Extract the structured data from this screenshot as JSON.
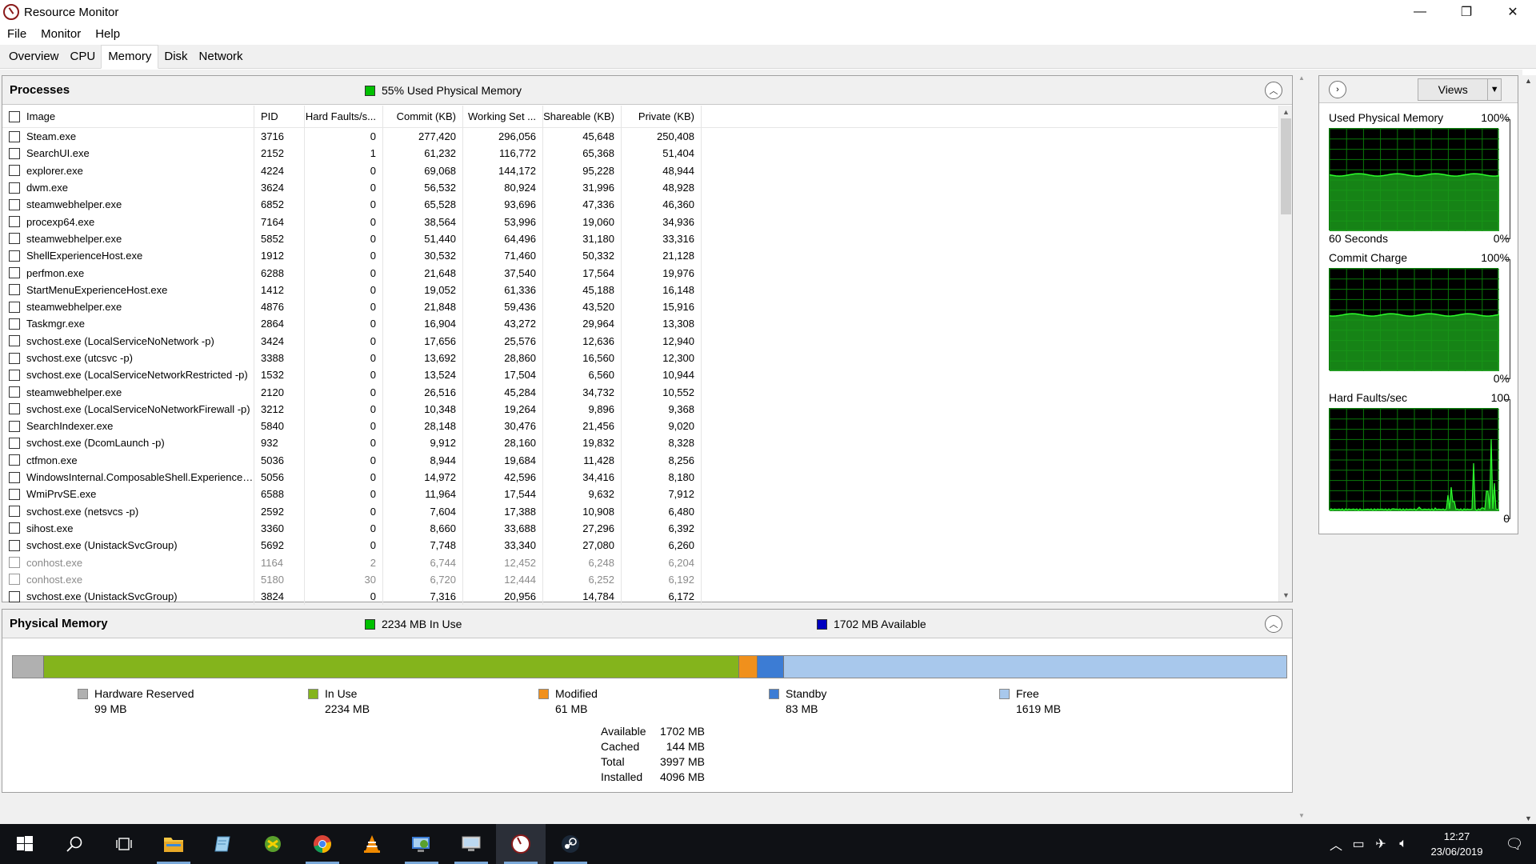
{
  "window": {
    "title": "Resource Monitor",
    "minimize": "—",
    "maximize": "❐",
    "close": "✕"
  },
  "menu": [
    "File",
    "Monitor",
    "Help"
  ],
  "tabs": [
    "Overview",
    "CPU",
    "Memory",
    "Disk",
    "Network"
  ],
  "active_tab": "Memory",
  "processes": {
    "title": "Processes",
    "status": "55% Used Physical Memory",
    "status_color": "#00c000",
    "columns": [
      "Image",
      "PID",
      "Hard Faults/s...",
      "Commit (KB)",
      "Working Set ...",
      "Shareable (KB)",
      "Private (KB)"
    ],
    "rows": [
      {
        "image": "Steam.exe",
        "pid": "3716",
        "hf": "0",
        "commit": "277,420",
        "ws": "296,056",
        "share": "45,648",
        "priv": "250,408"
      },
      {
        "image": "SearchUI.exe",
        "pid": "2152",
        "hf": "1",
        "commit": "61,232",
        "ws": "116,772",
        "share": "65,368",
        "priv": "51,404"
      },
      {
        "image": "explorer.exe",
        "pid": "4224",
        "hf": "0",
        "commit": "69,068",
        "ws": "144,172",
        "share": "95,228",
        "priv": "48,944"
      },
      {
        "image": "dwm.exe",
        "pid": "3624",
        "hf": "0",
        "commit": "56,532",
        "ws": "80,924",
        "share": "31,996",
        "priv": "48,928"
      },
      {
        "image": "steamwebhelper.exe",
        "pid": "6852",
        "hf": "0",
        "commit": "65,528",
        "ws": "93,696",
        "share": "47,336",
        "priv": "46,360"
      },
      {
        "image": "procexp64.exe",
        "pid": "7164",
        "hf": "0",
        "commit": "38,564",
        "ws": "53,996",
        "share": "19,060",
        "priv": "34,936"
      },
      {
        "image": "steamwebhelper.exe",
        "pid": "5852",
        "hf": "0",
        "commit": "51,440",
        "ws": "64,496",
        "share": "31,180",
        "priv": "33,316"
      },
      {
        "image": "ShellExperienceHost.exe",
        "pid": "1912",
        "hf": "0",
        "commit": "30,532",
        "ws": "71,460",
        "share": "50,332",
        "priv": "21,128"
      },
      {
        "image": "perfmon.exe",
        "pid": "6288",
        "hf": "0",
        "commit": "21,648",
        "ws": "37,540",
        "share": "17,564",
        "priv": "19,976"
      },
      {
        "image": "StartMenuExperienceHost.exe",
        "pid": "1412",
        "hf": "0",
        "commit": "19,052",
        "ws": "61,336",
        "share": "45,188",
        "priv": "16,148"
      },
      {
        "image": "steamwebhelper.exe",
        "pid": "4876",
        "hf": "0",
        "commit": "21,848",
        "ws": "59,436",
        "share": "43,520",
        "priv": "15,916"
      },
      {
        "image": "Taskmgr.exe",
        "pid": "2864",
        "hf": "0",
        "commit": "16,904",
        "ws": "43,272",
        "share": "29,964",
        "priv": "13,308"
      },
      {
        "image": "svchost.exe (LocalServiceNoNetwork -p)",
        "pid": "3424",
        "hf": "0",
        "commit": "17,656",
        "ws": "25,576",
        "share": "12,636",
        "priv": "12,940"
      },
      {
        "image": "svchost.exe (utcsvc -p)",
        "pid": "3388",
        "hf": "0",
        "commit": "13,692",
        "ws": "28,860",
        "share": "16,560",
        "priv": "12,300"
      },
      {
        "image": "svchost.exe (LocalServiceNetworkRestricted -p)",
        "pid": "1532",
        "hf": "0",
        "commit": "13,524",
        "ws": "17,504",
        "share": "6,560",
        "priv": "10,944"
      },
      {
        "image": "steamwebhelper.exe",
        "pid": "2120",
        "hf": "0",
        "commit": "26,516",
        "ws": "45,284",
        "share": "34,732",
        "priv": "10,552"
      },
      {
        "image": "svchost.exe (LocalServiceNoNetworkFirewall -p)",
        "pid": "3212",
        "hf": "0",
        "commit": "10,348",
        "ws": "19,264",
        "share": "9,896",
        "priv": "9,368"
      },
      {
        "image": "SearchIndexer.exe",
        "pid": "5840",
        "hf": "0",
        "commit": "28,148",
        "ws": "30,476",
        "share": "21,456",
        "priv": "9,020"
      },
      {
        "image": "svchost.exe (DcomLaunch -p)",
        "pid": "932",
        "hf": "0",
        "commit": "9,912",
        "ws": "28,160",
        "share": "19,832",
        "priv": "8,328"
      },
      {
        "image": "ctfmon.exe",
        "pid": "5036",
        "hf": "0",
        "commit": "8,944",
        "ws": "19,684",
        "share": "11,428",
        "priv": "8,256"
      },
      {
        "image": "WindowsInternal.ComposableShell.Experiences...",
        "pid": "5056",
        "hf": "0",
        "commit": "14,972",
        "ws": "42,596",
        "share": "34,416",
        "priv": "8,180"
      },
      {
        "image": "WmiPrvSE.exe",
        "pid": "6588",
        "hf": "0",
        "commit": "11,964",
        "ws": "17,544",
        "share": "9,632",
        "priv": "7,912"
      },
      {
        "image": "svchost.exe (netsvcs -p)",
        "pid": "2592",
        "hf": "0",
        "commit": "7,604",
        "ws": "17,388",
        "share": "10,908",
        "priv": "6,480"
      },
      {
        "image": "sihost.exe",
        "pid": "3360",
        "hf": "0",
        "commit": "8,660",
        "ws": "33,688",
        "share": "27,296",
        "priv": "6,392"
      },
      {
        "image": "svchost.exe (UnistackSvcGroup)",
        "pid": "5692",
        "hf": "0",
        "commit": "7,748",
        "ws": "33,340",
        "share": "27,080",
        "priv": "6,260"
      },
      {
        "image": "conhost.exe",
        "pid": "1164",
        "hf": "2",
        "commit": "6,744",
        "ws": "12,452",
        "share": "6,248",
        "priv": "6,204",
        "dim": true
      },
      {
        "image": "conhost.exe",
        "pid": "5180",
        "hf": "30",
        "commit": "6,720",
        "ws": "12,444",
        "share": "6,252",
        "priv": "6,192",
        "dim": true
      },
      {
        "image": "svchost.exe (UnistackSvcGroup)",
        "pid": "3824",
        "hf": "0",
        "commit": "7,316",
        "ws": "20,956",
        "share": "14,784",
        "priv": "6,172"
      }
    ]
  },
  "physical_memory": {
    "title": "Physical Memory",
    "in_use_status": "2234 MB In Use",
    "available_status": "1702 MB Available",
    "in_use_color": "#00c000",
    "available_color": "#0000c0",
    "segments": [
      {
        "name": "Hardware Reserved",
        "value": "99 MB",
        "mb": 99,
        "color": "#b0b0b0"
      },
      {
        "name": "In Use",
        "value": "2234 MB",
        "mb": 2234,
        "color": "#84b41c"
      },
      {
        "name": "Modified",
        "value": "61 MB",
        "mb": 61,
        "color": "#f0901c"
      },
      {
        "name": "Standby",
        "value": "83 MB",
        "mb": 83,
        "color": "#3c7cd4"
      },
      {
        "name": "Free",
        "value": "1619 MB",
        "mb": 1619,
        "color": "#a8c8ec"
      }
    ],
    "summary": [
      {
        "k": "Available",
        "v": "1702 MB"
      },
      {
        "k": "Cached",
        "v": "144 MB"
      },
      {
        "k": "Total",
        "v": "3997 MB"
      },
      {
        "k": "Installed",
        "v": "4096 MB"
      }
    ]
  },
  "side": {
    "views_label": "Views",
    "graphs": [
      {
        "name": "Used Physical Memory",
        "max": "100%",
        "left_bottom": "60 Seconds",
        "right_bottom": "0%",
        "level": 0.55
      },
      {
        "name": "Commit Charge",
        "max": "100%",
        "left_bottom": "",
        "right_bottom": "0%",
        "level": 0.55
      },
      {
        "name": "Hard Faults/sec",
        "max": "100",
        "left_bottom": "",
        "right_bottom": "0",
        "level": 0.0
      }
    ]
  },
  "taskbar": {
    "icons": [
      "start-icon",
      "search-icon",
      "task-view-icon",
      "file-explorer-icon",
      "notepad-icon",
      "greenshot-icon",
      "chrome-icon",
      "vlc-icon",
      "control-panel-icon",
      "monitor-icon",
      "resource-monitor-icon",
      "steam-icon"
    ],
    "time": "12:27",
    "date": "23/06/2019"
  }
}
